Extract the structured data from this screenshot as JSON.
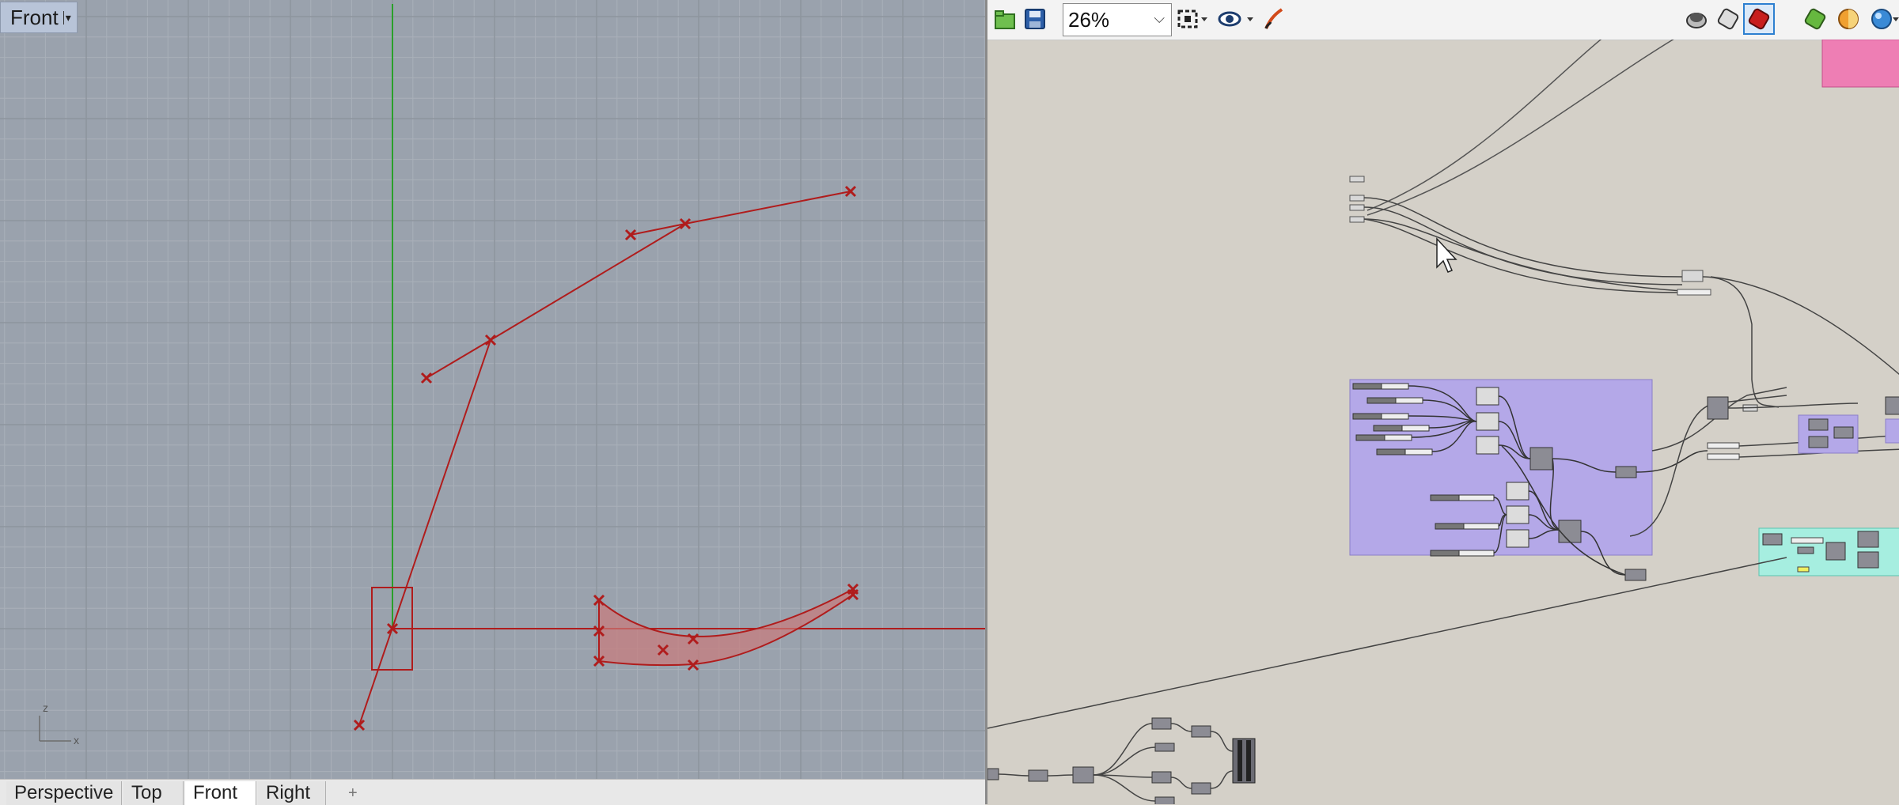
{
  "rhino": {
    "active_viewport": "Front",
    "axis_labels": {
      "x": "x",
      "z": "z"
    },
    "tabs": [
      {
        "label": "Perspective",
        "active": false
      },
      {
        "label": "Top",
        "active": false
      },
      {
        "label": "Front",
        "active": true
      },
      {
        "label": "Right",
        "active": false
      }
    ],
    "add_tab_symbol": "+",
    "colors": {
      "viewport_bg": "#9aa2ad",
      "curve": "#b01c1c",
      "y_axis": "#2aa02a"
    }
  },
  "grasshopper": {
    "zoom": "26%",
    "toolbar_icons": [
      "open-file-icon",
      "save-file-icon",
      "zoom-extents-icon",
      "preview-eye-icon",
      "sketch-brush-icon",
      "preview-wireframe-icon",
      "preview-shaded-icon",
      "preview-selected-icon",
      "preview-settings-icon",
      "material-icon",
      "sphere-icon"
    ],
    "colors": {
      "canvas": "#d4d0c8",
      "group_purple": "#b4a8e8",
      "group_cyan": "#a6eee0",
      "group_pink": "#ee7eb4",
      "component": "#8c8c94"
    }
  }
}
